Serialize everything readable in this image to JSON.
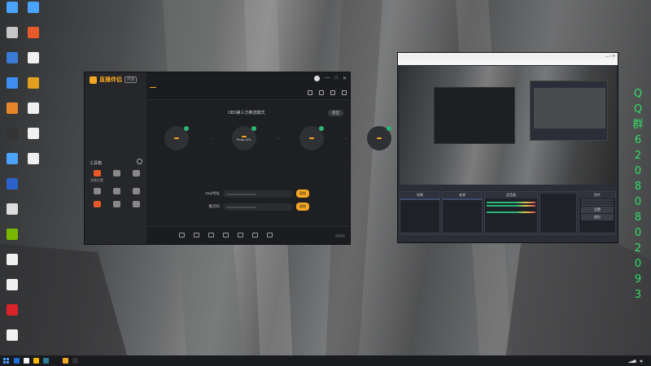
{
  "desktop": {
    "icons_col1": [
      {
        "label": "",
        "color": "#4aa3ff"
      },
      {
        "label": "",
        "color": "#c6c6c6"
      },
      {
        "label": "",
        "color": "#3a7bd5"
      },
      {
        "label": "",
        "color": "#3d8ef0"
      },
      {
        "label": "",
        "color": "#e8862a"
      },
      {
        "label": "",
        "color": "#333"
      },
      {
        "label": "",
        "color": "#4aa3ff"
      },
      {
        "label": "",
        "color": "#2a62c9"
      },
      {
        "label": "",
        "color": "#ddd"
      },
      {
        "label": "",
        "color": "#76b900"
      },
      {
        "label": "",
        "color": "#f0f0f0"
      },
      {
        "label": "",
        "color": "#f0f0f0"
      },
      {
        "label": "",
        "color": "#d8232a"
      },
      {
        "label": "",
        "color": "#f0f0f0"
      }
    ],
    "icons_col2": [
      {
        "label": "",
        "color": "#4aa3ff"
      },
      {
        "label": "",
        "color": "#e85a2a"
      },
      {
        "label": "",
        "color": "#f0f0f0"
      },
      {
        "label": "",
        "color": "#e3a020"
      },
      {
        "label": "",
        "color": "#f0f0f0"
      },
      {
        "label": "",
        "color": "#f0f0f0"
      },
      {
        "label": "",
        "color": "#f0f0f0"
      }
    ]
  },
  "app": {
    "logo_name": "直播伴侣",
    "version": "内测",
    "side_tabs": [
      "",
      "",
      ""
    ],
    "side_empty": "",
    "toolbox_title": "工具箱",
    "tools": [
      {
        "label": "直播设置",
        "hot": true
      },
      {
        "label": "",
        "hot": false
      },
      {
        "label": "",
        "hot": false
      },
      {
        "label": "",
        "hot": false
      },
      {
        "label": "",
        "hot": false
      },
      {
        "label": "",
        "hot": false
      },
      {
        "label": "",
        "hot": true
      },
      {
        "label": "",
        "hot": false
      },
      {
        "label": "",
        "hot": false
      }
    ],
    "side_footer": "",
    "tabs": [
      {
        "label": "",
        "tag": ""
      },
      {
        "label": "",
        "tag": ""
      }
    ],
    "mode_title": "OBS第三方推流模式",
    "exit_label": "退出",
    "steps": [
      {
        "inner": "",
        "text": "",
        "caption": ""
      },
      {
        "inner": "",
        "text": "Rtmp URL",
        "caption": ""
      },
      {
        "inner": "",
        "text": "",
        "caption": ""
      },
      {
        "inner": "",
        "text": "",
        "caption": ""
      }
    ],
    "arrow": "→",
    "fields": [
      {
        "label": "rtmp地址",
        "value": "••••••••••••••••••••••••••",
        "button": "复制"
      },
      {
        "label": "推流码",
        "value": "••••••••••••••••••••••••••",
        "button": "复制"
      }
    ],
    "hint": "",
    "bottom_tools": [
      "",
      "",
      "",
      "",
      "",
      "",
      ""
    ],
    "live_btn": "",
    "win_controls": [
      "—",
      "□",
      "✕"
    ]
  },
  "obs": {
    "title": "",
    "title_controls": "—  □  ✕",
    "menu": [
      "",
      "",
      "",
      "",
      "",
      "",
      ""
    ],
    "scene_label": "",
    "source_label": "",
    "docks": {
      "scenes_header": "场景",
      "scenes": [
        ""
      ],
      "sources_header": "来源",
      "sources": [
        "",
        ""
      ],
      "mixer_header": "混音器",
      "mixer": [
        "",
        ""
      ],
      "transitions_header": "",
      "transitions": [
        "",
        ""
      ],
      "controls_header": "控件",
      "controls": [
        "",
        "",
        "",
        "设置",
        "退出"
      ]
    },
    "status": [
      "",
      "",
      "",
      ""
    ]
  },
  "qq_text": [
    "Q",
    "Q",
    "群",
    "6",
    "2",
    "0",
    "8",
    "0",
    "8",
    "0",
    "2",
    "0",
    "9",
    "3"
  ],
  "watermark": "",
  "taskbar": {
    "items": [
      "#1e6fd9",
      "#f3f3f3",
      "#ffb900",
      "#2d7d9a",
      "#1a1a1a",
      "#f5a623",
      "#333"
    ],
    "time": "",
    "date": ""
  }
}
